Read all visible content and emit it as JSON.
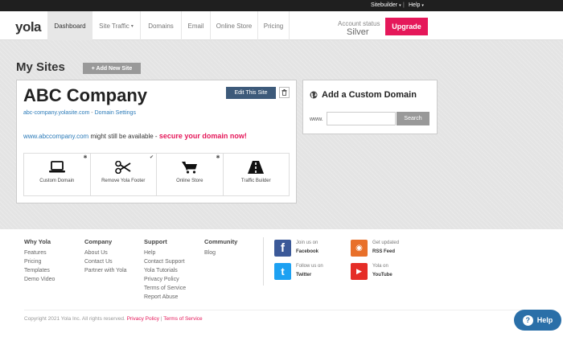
{
  "topbar": {
    "sitebuilder": "Sitebuilder",
    "help": "Help",
    "separator": "|",
    "caret": "▾"
  },
  "header": {
    "logo": "yola",
    "nav": [
      {
        "label": "Dashboard",
        "active": true
      },
      {
        "label": "Site Traffic",
        "caret": "▾"
      },
      {
        "label": "Domains"
      },
      {
        "label": "Email"
      },
      {
        "label": "Online Store"
      },
      {
        "label": "Pricing"
      }
    ],
    "account_status_label": "Account status",
    "account_status_value": "Silver",
    "upgrade_label": "Upgrade"
  },
  "main": {
    "title": "My Sites",
    "add_site_label": "+ Add New Site",
    "site": {
      "name": "ABC Company",
      "edit_label": "Edit This Site",
      "url": "abc-company.yolasite.com",
      "link_separator": " - ",
      "domain_settings": "Domain Settings",
      "available_domain": "www.abccompany.com",
      "available_text": " might still be available - ",
      "secure_text": "secure your domain now!",
      "features": [
        {
          "label": "Custom Domain",
          "icon": "laptop-icon",
          "mark": "✱"
        },
        {
          "label": "Remove Yola Footer",
          "icon": "scissors-icon",
          "mark": "✔"
        },
        {
          "label": "Online Store",
          "icon": "cart-icon",
          "mark": "✱"
        },
        {
          "label": "Traffic Builder",
          "icon": "road-icon",
          "mark": ""
        }
      ]
    },
    "custom_domain": {
      "title": "Add a Custom Domain",
      "www_label": "www.",
      "input_value": "",
      "search_label": "Search"
    }
  },
  "footer": {
    "columns": [
      {
        "heading": "Why Yola",
        "links": [
          "Features",
          "Pricing",
          "Templates",
          "Demo Video"
        ]
      },
      {
        "heading": "Company",
        "links": [
          "About Us",
          "Contact Us",
          "Partner with Yola"
        ]
      },
      {
        "heading": "Support",
        "links": [
          "Help",
          "Contact Support",
          "Yola Tutorials",
          "Privacy Policy",
          "Terms of Service",
          "Report Abuse"
        ]
      },
      {
        "heading": "Community",
        "links": [
          "Blog"
        ]
      }
    ],
    "social": [
      {
        "line1": "Join us on",
        "line2": "Facebook",
        "icon": "facebook-icon",
        "color": "#3b5998",
        "glyph": "f"
      },
      {
        "line1": "Get updated",
        "line2": "RSS Feed",
        "icon": "rss-icon",
        "color": "#e8702a",
        "glyph": "◉"
      },
      {
        "line1": "Follow us on",
        "line2": "Twitter",
        "icon": "twitter-icon",
        "color": "#1da1f2",
        "glyph": "t"
      },
      {
        "line1": "Yola on",
        "line2": "YouTube",
        "icon": "youtube-icon",
        "color": "#e52d27",
        "glyph": "▶"
      }
    ],
    "copyright": "Copyright 2021 Yola Inc. All rights reserved.",
    "privacy_link": "Privacy Policy",
    "link_separator": "|",
    "terms_link": "Terms of Service"
  },
  "help_widget": {
    "label": "Help",
    "glyph": "?"
  },
  "colors": {
    "accent": "#e5185a",
    "link": "#2a7ab8",
    "edit_button": "#3d5a7a",
    "help_button": "#2a6fa8"
  }
}
